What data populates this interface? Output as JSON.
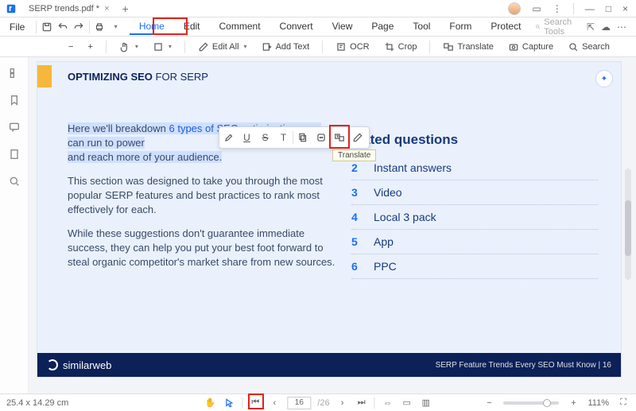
{
  "window": {
    "tab_title": "SERP trends.pdf *",
    "minimize": "—",
    "maximize": "□",
    "close": "×"
  },
  "menubar": {
    "file": "File",
    "items": [
      "Home",
      "Edit",
      "Comment",
      "Convert",
      "View",
      "Page",
      "Tool",
      "Form",
      "Protect"
    ],
    "active_index": 0,
    "search_placeholder": "Search Tools"
  },
  "toolbar": {
    "minus": "−",
    "plus": "+",
    "edit_all": "Edit All",
    "add_text": "Add Text",
    "ocr": "OCR",
    "crop": "Crop",
    "translate": "Translate",
    "capture": "Capture",
    "search": "Search"
  },
  "sidebar": {
    "items": [
      "thumbnails",
      "bookmarks",
      "comments",
      "attachments",
      "search"
    ]
  },
  "doc": {
    "title_bold": "OPTIMIZING SEO",
    "title_rest": " FOR SERP",
    "p1_a": "Here we'll breakdown ",
    "p1_link": "6 types of SEO optimizations",
    "p1_b": " you can run to power",
    "p1_c": "and reach more of your audience.",
    "p2": "This section was designed to take you through the most popular SERP features and best practices to rank most effectively for each.",
    "p3": "While these suggestions don't guarantee immediate success, they can help you put your best foot forward to steal organic competitor's market share from new sources.",
    "right_heading_tail": "elated questions",
    "list": [
      {
        "n": "2",
        "label": "Instant answers"
      },
      {
        "n": "3",
        "label": "Video"
      },
      {
        "n": "4",
        "label": "Local 3 pack"
      },
      {
        "n": "5",
        "label": "App"
      },
      {
        "n": "6",
        "label": "PPC"
      }
    ],
    "brand": "similarweb",
    "footer_text": "SERP Feature Trends Every SEO Must Know |   16"
  },
  "floatbar": {
    "tools": [
      "highlight",
      "underline",
      "strikethrough",
      "text-format",
      "copy",
      "ai",
      "translate",
      "edit"
    ],
    "tooltip": "Translate"
  },
  "status": {
    "coords": "25.4 x 14.29 cm",
    "page": "16",
    "pages": "/26",
    "zoom": "111%"
  },
  "colors": {
    "accent": "#1a6ff1",
    "red": "#e2231a"
  }
}
